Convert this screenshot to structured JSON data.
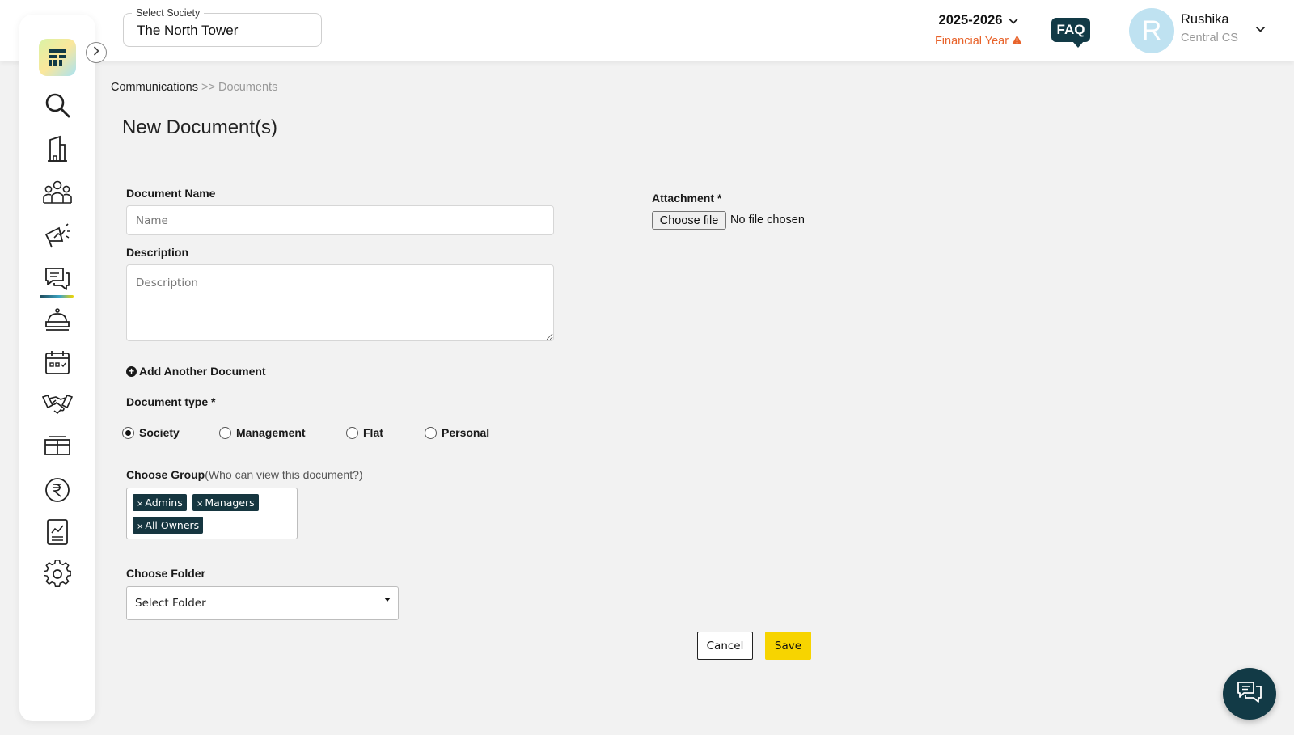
{
  "header": {
    "society_label": "Select Society",
    "society_value": "The North Tower",
    "financial_year": "2025-2026",
    "financial_year_label": "Financial Year",
    "faq_label": "FAQ",
    "user_initial": "R",
    "user_name": "Rushika",
    "user_role": "Central CS"
  },
  "sidebar": {
    "items": [
      {
        "icon": "search-icon"
      },
      {
        "icon": "building-icon"
      },
      {
        "icon": "people-icon"
      },
      {
        "icon": "megaphone-icon"
      },
      {
        "icon": "chat-icon",
        "active": true
      },
      {
        "icon": "service-bell-icon"
      },
      {
        "icon": "calendar-icon"
      },
      {
        "icon": "handshake-icon"
      },
      {
        "icon": "box-icon"
      },
      {
        "icon": "rupee-icon"
      },
      {
        "icon": "report-icon"
      },
      {
        "icon": "gear-icon"
      }
    ]
  },
  "breadcrumb": {
    "parent": "Communications",
    "separator": ">>",
    "current": "Documents"
  },
  "page": {
    "title": "New Document(s)"
  },
  "form": {
    "document_name_label": "Document Name",
    "document_name_placeholder": "Name",
    "description_label": "Description",
    "description_placeholder": "Description",
    "attachment_label": "Attachment *",
    "choose_file_label": "Choose file",
    "file_status": "No file chosen",
    "add_another_label": "Add Another Document",
    "document_type_label": "Document type *",
    "document_types": [
      "Society",
      "Management",
      "Flat",
      "Personal"
    ],
    "selected_type": "Society",
    "choose_group_label": "Choose Group",
    "choose_group_hint": "(Who can view this document?)",
    "groups": [
      "Admins",
      "Managers",
      "All Owners"
    ],
    "tag_remove_symbol": "×",
    "choose_folder_label": "Choose Folder",
    "folder_value": "Select Folder",
    "cancel_label": "Cancel",
    "save_label": "Save"
  },
  "colors": {
    "accent_yellow": "#f7d400",
    "dark_teal": "#123a46",
    "warning_orange": "#e8632b"
  }
}
